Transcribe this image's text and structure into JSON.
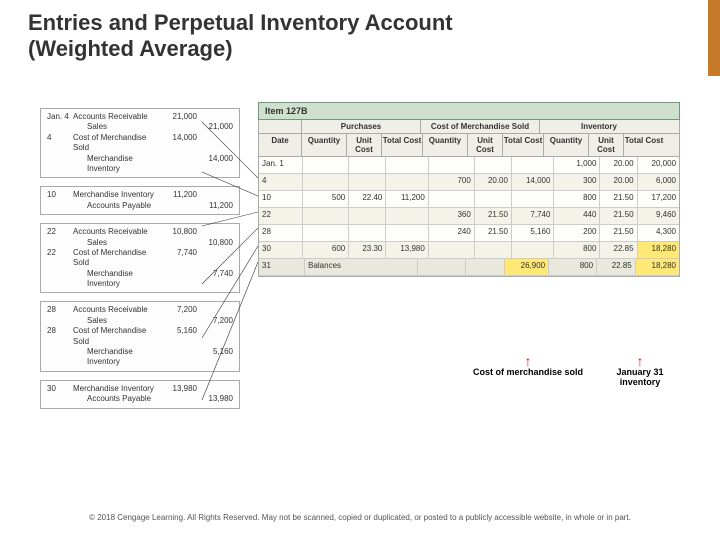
{
  "title_line1": "Entries and Perpetual Inventory Account",
  "title_line2": "(Weighted Average)",
  "item_label": "Item 127B",
  "col_groups": {
    "purchases": "Purchases",
    "cms": "Cost of Merchandise Sold",
    "inv": "Inventory"
  },
  "cols": {
    "date": "Date",
    "qty": "Quantity",
    "uc": "Unit Cost",
    "tc": "Total Cost"
  },
  "journal": [
    {
      "date": "Jan. 4",
      "rows": [
        {
          "acct": "Accounts Receivable",
          "d": "21,000",
          "c": ""
        },
        {
          "acct": "Sales",
          "indent": true,
          "d": "",
          "c": "21,000"
        }
      ]
    },
    {
      "date": "4",
      "rows": [
        {
          "acct": "Cost of Merchandise Sold",
          "d": "14,000",
          "c": ""
        },
        {
          "acct": "Merchandise Inventory",
          "indent": true,
          "d": "",
          "c": "14,000"
        }
      ]
    },
    {
      "date": "10",
      "rows": [
        {
          "acct": "Merchandise Inventory",
          "d": "11,200",
          "c": ""
        },
        {
          "acct": "Accounts Payable",
          "indent": true,
          "d": "",
          "c": "11,200"
        }
      ]
    },
    {
      "date": "22",
      "rows": [
        {
          "acct": "Accounts Receivable",
          "d": "10,800",
          "c": ""
        },
        {
          "acct": "Sales",
          "indent": true,
          "d": "",
          "c": "10,800"
        }
      ]
    },
    {
      "date": "22",
      "rows": [
        {
          "acct": "Cost of Merchandise Sold",
          "d": "7,740",
          "c": ""
        },
        {
          "acct": "Merchandise Inventory",
          "indent": true,
          "d": "",
          "c": "7,740"
        }
      ]
    },
    {
      "date": "28",
      "rows": [
        {
          "acct": "Accounts Receivable",
          "d": "7,200",
          "c": ""
        },
        {
          "acct": "Sales",
          "indent": true,
          "d": "",
          "c": "7,200"
        }
      ]
    },
    {
      "date": "28",
      "rows": [
        {
          "acct": "Cost of Merchandise Sold",
          "d": "5,160",
          "c": ""
        },
        {
          "acct": "Merchandise Inventory",
          "indent": true,
          "d": "",
          "c": "5,160"
        }
      ]
    },
    {
      "date": "30",
      "rows": [
        {
          "acct": "Merchandise Inventory",
          "d": "13,980",
          "c": ""
        },
        {
          "acct": "Accounts Payable",
          "indent": true,
          "d": "",
          "c": "13,980"
        }
      ]
    }
  ],
  "ledger": [
    {
      "date": "Jan. 1",
      "pq": "",
      "puc": "",
      "ptc": "",
      "cq": "",
      "cuc": "",
      "ctc": "",
      "iq": "1,000",
      "iuc": "20.00",
      "itc": "20,000"
    },
    {
      "date": "4",
      "pq": "",
      "puc": "",
      "ptc": "",
      "cq": "700",
      "cuc": "20.00",
      "ctc": "14,000",
      "iq": "300",
      "iuc": "20.00",
      "itc": "6,000"
    },
    {
      "date": "10",
      "pq": "500",
      "puc": "22.40",
      "ptc": "11,200",
      "cq": "",
      "cuc": "",
      "ctc": "",
      "iq": "800",
      "iuc": "21.50",
      "itc": "17,200"
    },
    {
      "date": "22",
      "pq": "",
      "puc": "",
      "ptc": "",
      "cq": "360",
      "cuc": "21.50",
      "ctc": "7,740",
      "iq": "440",
      "iuc": "21.50",
      "itc": "9,460"
    },
    {
      "date": "28",
      "pq": "",
      "puc": "",
      "ptc": "",
      "cq": "240",
      "cuc": "21.50",
      "ctc": "5,160",
      "iq": "200",
      "iuc": "21.50",
      "itc": "4,300"
    },
    {
      "date": "30",
      "pq": "600",
      "puc": "23.30",
      "ptc": "13,980",
      "cq": "",
      "cuc": "",
      "ctc": "",
      "iq": "800",
      "iuc": "22.85",
      "itc": "18,280",
      "hl_itc": true
    },
    {
      "date": "31",
      "balances": "Balances",
      "ctc": "26,900",
      "iq": "800",
      "iuc": "22.85",
      "itc": "18,280",
      "hl_ctc": true,
      "hl_itc": true
    }
  ],
  "ann": {
    "cms": "Cost of merchandise sold",
    "inv": "January 31 inventory"
  },
  "copyright": "© 2018 Cengage Learning. All Rights Reserved. May not be scanned, copied or duplicated, or posted to a publicly accessible website, in whole or in part."
}
